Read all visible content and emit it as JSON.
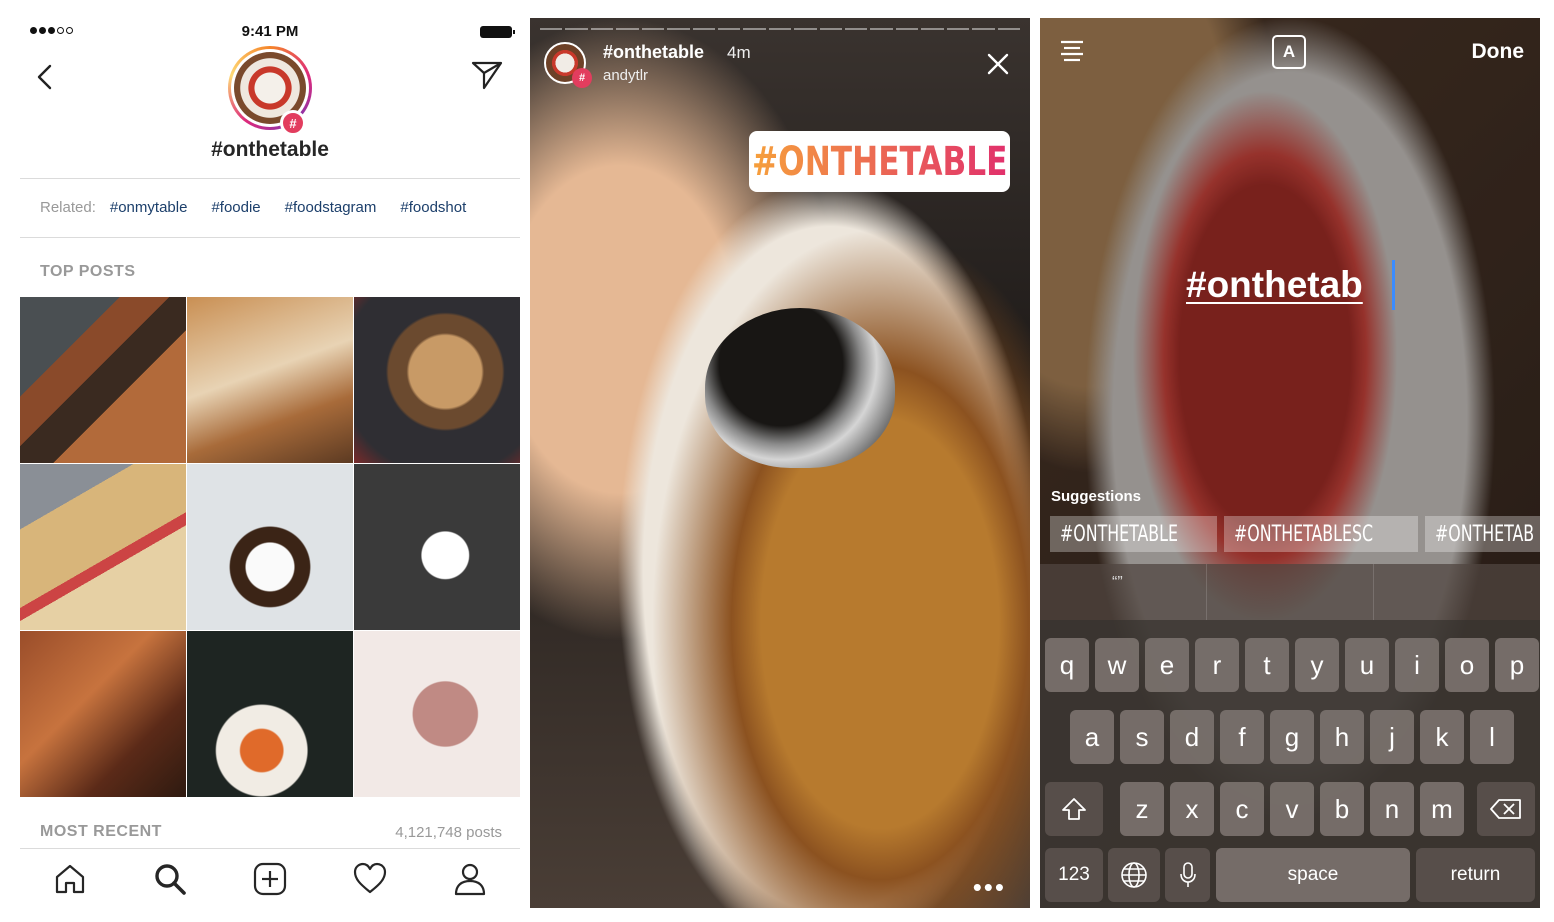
{
  "panel1": {
    "status": {
      "time": "9:41 PM"
    },
    "hashtag": "#onthetable",
    "badge": "#",
    "related_label": "Related:",
    "related": [
      "#onmytable",
      "#foodie",
      "#foodstagram",
      "#foodshot"
    ],
    "top_posts_label": "TOP POSTS",
    "most_recent_label": "MOST RECENT",
    "post_count": "4,121,748 posts",
    "tabs": [
      "home-icon",
      "search-icon",
      "add-icon",
      "heart-icon",
      "profile-icon"
    ]
  },
  "panel2": {
    "hashtag": "#onthetable",
    "time_ago": "4m",
    "username": "andytlr",
    "badge": "#",
    "sticker_text": "#ONTHETABLE",
    "more": "•••"
  },
  "panel3": {
    "font_button": "A",
    "done_label": "Done",
    "typed_text": "#onthetab",
    "suggestions_label": "Suggestions",
    "suggestions": [
      "#ONTHETABLE",
      "#ONTHETABLESC",
      "#ONTHETAB",
      "#"
    ],
    "predictions": [
      "“”",
      "",
      ""
    ],
    "keyboard": {
      "row1": [
        "q",
        "w",
        "e",
        "r",
        "t",
        "y",
        "u",
        "i",
        "o",
        "p"
      ],
      "row2": [
        "a",
        "s",
        "d",
        "f",
        "g",
        "h",
        "j",
        "k",
        "l"
      ],
      "row3": [
        "z",
        "x",
        "c",
        "v",
        "b",
        "n",
        "m"
      ],
      "num_label": "123",
      "space_label": "space",
      "return_label": "return"
    }
  }
}
